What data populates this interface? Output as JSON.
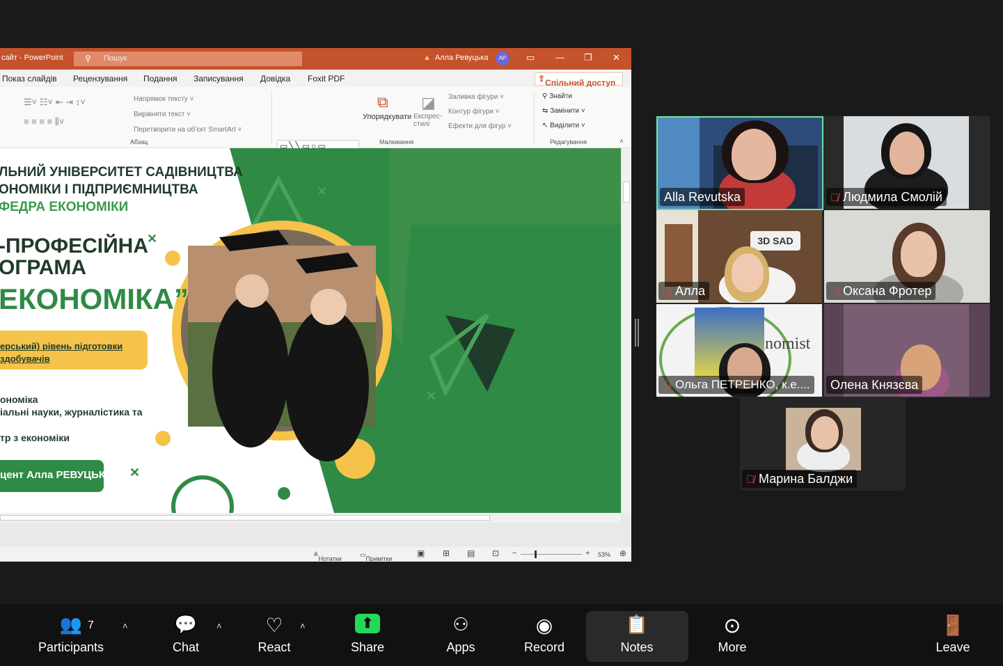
{
  "ppt": {
    "title": "сайт  -  PowerPoint",
    "search_placeholder": "Пошук",
    "user_name": "Алла Ревуцька",
    "user_initials": "АР",
    "menu": [
      "Показ слайдів",
      "Рецензування",
      "Подання",
      "Записування",
      "Довідка",
      "Foxit PDF"
    ],
    "share_button": "Спільний доступ",
    "ribbon": {
      "text_direction": "Напрямок тексту ˅",
      "align_text": "Вирівняти текст ˅",
      "smartart": "Перетворити на об’єкт SmartArt ˅",
      "paragraph_group": "Абзац",
      "arrange": "Упорядкувати",
      "quick_styles": "Експрес-стилі",
      "shape_fill": "Заливка фігури ˅",
      "shape_outline": "Контур фігури ˅",
      "shape_effects": "Ефекти для фігур ˅",
      "drawing_group": "Малювання",
      "find": "Знайти",
      "replace": "Замінити",
      "select": "Виділити ˅",
      "editing_group": "Редагування"
    },
    "slide": {
      "line1": "ЛЬНИЙ УНІВЕРСИТЕТ САДІВНИЦТВА",
      "line2": "ОНОМІКИ І ПІДПРИЄМНИЦТВА",
      "line3": "ФЕДРА ЕКОНОМІКИ",
      "line4": "-ПРОФЕСІЙНА",
      "line5": "ОГРАМА",
      "line6": "ЕКОНОМІКА”",
      "pill1": "ерський) рівень підготовки",
      "pill2": "здобувачів",
      "info1": "ономіка",
      "info2": "іальні науки, журналістика та",
      "info3": "тр з економіки",
      "btn": "цент Алла РЕВУЦЬКА"
    },
    "status": {
      "notes": "Нотатки",
      "comments": "Примітки",
      "zoom": "53%"
    }
  },
  "participants_tiles": [
    {
      "name": "Alla Revutska",
      "muted": false,
      "active": true
    },
    {
      "name": "Людмила Смолій",
      "muted": true,
      "active": false
    },
    {
      "name": "Алла",
      "muted": true,
      "active": false
    },
    {
      "name": "Оксана Фротер",
      "muted": true,
      "active": false
    },
    {
      "name": "Ольга ПЕТРЕНКО, к.е....",
      "muted": true,
      "active": false
    },
    {
      "name": "Олена Князєва",
      "muted": false,
      "active": false
    },
    {
      "name": "Марина Балджи",
      "muted": true,
      "active": false
    }
  ],
  "background_text": {
    "sad_sign": "3D SAD",
    "ekonomist": "nomist"
  },
  "toolbar": {
    "participants": "Participants",
    "participants_count": "7",
    "chat": "Chat",
    "react": "React",
    "share": "Share",
    "apps": "Apps",
    "record": "Record",
    "notes": "Notes",
    "more": "More",
    "leave": "Leave"
  },
  "colors": {
    "ppt_accent": "#c4522b",
    "slide_green": "#2f8a45",
    "slide_yellow": "#f5c34a",
    "active_speaker": "#6fe3a0",
    "muted_red": "#e0413a",
    "share_green": "#23d959"
  }
}
